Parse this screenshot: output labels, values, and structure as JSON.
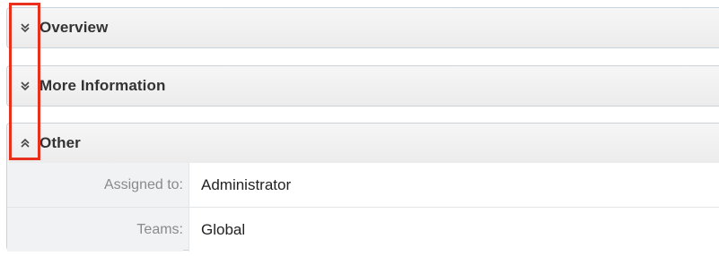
{
  "panels": {
    "overview": {
      "title": "Overview",
      "icon": "chevron-double-down-icon",
      "expanded": false
    },
    "more_information": {
      "title": "More Information",
      "icon": "chevron-double-down-icon",
      "expanded": false
    },
    "other": {
      "title": "Other",
      "icon": "chevron-double-up-icon",
      "expanded": true,
      "fields": [
        {
          "label": "Assigned to:",
          "value": "Administrator"
        },
        {
          "label": "Teams:",
          "value": "Global"
        }
      ]
    }
  },
  "annotation": {
    "color": "#e8301c"
  }
}
